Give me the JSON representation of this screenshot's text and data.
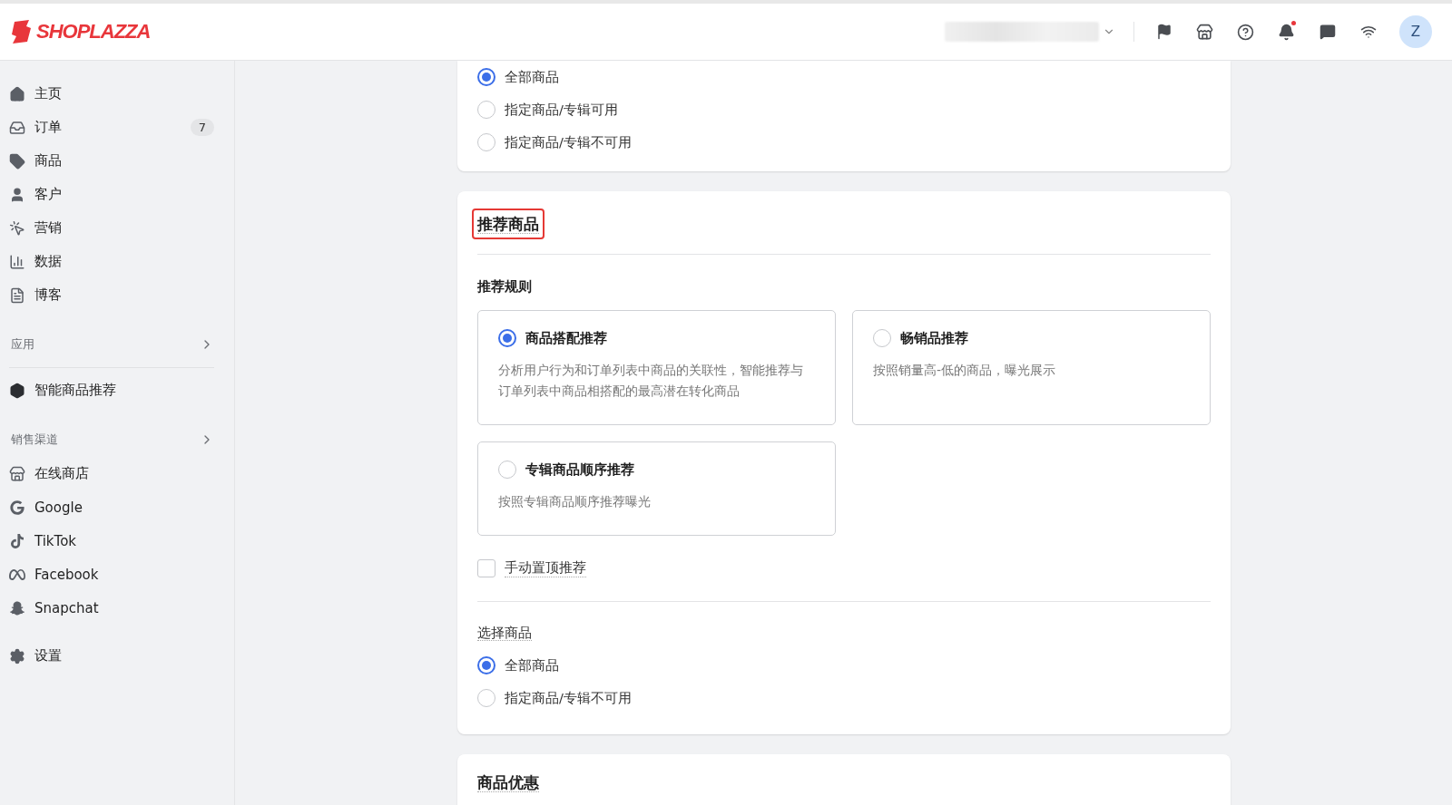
{
  "header": {
    "logo": "SHOPLAZZA",
    "avatar": "Z",
    "notification_dot": true
  },
  "sidebar": [
    {
      "kind": "item",
      "label": "主页"
    },
    {
      "kind": "item",
      "label": "订单",
      "badge": "7"
    },
    {
      "kind": "item",
      "label": "商品"
    },
    {
      "kind": "item",
      "label": "客户"
    },
    {
      "kind": "item",
      "label": "营销"
    },
    {
      "kind": "item",
      "label": "数据"
    },
    {
      "kind": "item",
      "label": "博客"
    },
    {
      "kind": "section",
      "label": "应用",
      "divider": true
    },
    {
      "kind": "item",
      "label": "智能商品推荐"
    },
    {
      "kind": "section",
      "label": "销售渠道",
      "divider": false
    },
    {
      "kind": "item",
      "label": "在线商店"
    },
    {
      "kind": "item",
      "label": "Google"
    },
    {
      "kind": "item",
      "label": "TikTok"
    },
    {
      "kind": "item",
      "label": "Facebook"
    },
    {
      "kind": "item",
      "label": "Snapchat"
    },
    {
      "kind": "gap"
    },
    {
      "kind": "item",
      "label": "设置"
    }
  ],
  "cards": [
    {
      "kind": "radio_list",
      "options": [
        {
          "label": "全部商品",
          "selected": true
        },
        {
          "label": "指定商品/专辑可用",
          "selected": false
        },
        {
          "label": "指定商品/专辑不可用",
          "selected": false
        }
      ]
    },
    {
      "kind": "recommend",
      "title": "推荐商品",
      "highlighted": true,
      "rule_label": "推荐规则",
      "rules": [
        {
          "title": "商品搭配推荐",
          "description": "分析用户行为和订单列表中商品的关联性，智能推荐与订单列表中商品相搭配的最高潜在转化商品",
          "selected": true
        },
        {
          "title": "畅销品推荐",
          "description": "按照销量高-低的商品，曝光展示",
          "selected": false
        },
        {
          "title": "专辑商品顺序推荐",
          "description": "按照专辑商品顺序推荐曝光",
          "selected": false
        }
      ],
      "pin": {
        "label": "手动置顶推荐",
        "checked": false
      },
      "select_label": "选择商品",
      "options": [
        {
          "label": "全部商品",
          "selected": true
        },
        {
          "label": "指定商品/专辑不可用",
          "selected": false
        }
      ]
    },
    {
      "kind": "title_only",
      "title": "商品优惠"
    }
  ]
}
